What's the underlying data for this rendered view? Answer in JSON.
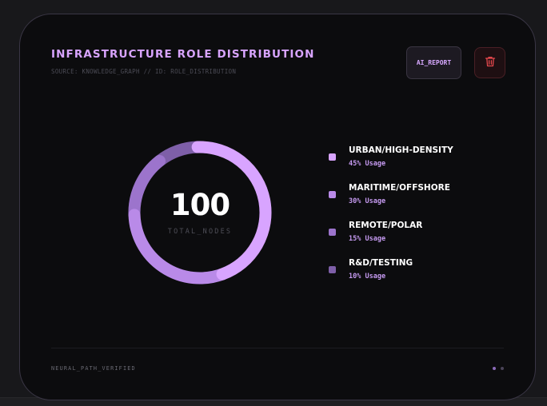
{
  "card": {
    "title": "INFRASTRUCTURE ROLE DISTRIBUTION",
    "subtitle": "SOURCE: KNOWLEDGE_GRAPH // ID: ROLE_DISTRIBUTION",
    "footer": "NEURAL_PATH_VERIFIED"
  },
  "actions": {
    "ai_report_label": "AI_REPORT",
    "delete_icon": "trash-icon"
  },
  "chart_data": {
    "type": "pie",
    "variant": "donut",
    "center_value": "100",
    "center_label": "TOTAL_NODES",
    "slices": [
      {
        "name": "URBAN/HIGH-DENSITY",
        "value": 45,
        "usage_label": "45% Usage",
        "color": "#d8a4ff"
      },
      {
        "name": "MARITIME/OFFSHORE",
        "value": 30,
        "usage_label": "30% Usage",
        "color": "#b98ae8"
      },
      {
        "name": "REMOTE/POLAR",
        "value": 15,
        "usage_label": "15% Usage",
        "color": "#9c74cc"
      },
      {
        "name": "R&D/TESTING",
        "value": 10,
        "usage_label": "10% Usage",
        "color": "#7e5fa8"
      }
    ]
  },
  "pagination": {
    "active_color": "#8b6bb8",
    "inactive_color": "#4a4458"
  },
  "colors": {
    "accent": "#d8a4ff",
    "danger": "#e5484d"
  }
}
